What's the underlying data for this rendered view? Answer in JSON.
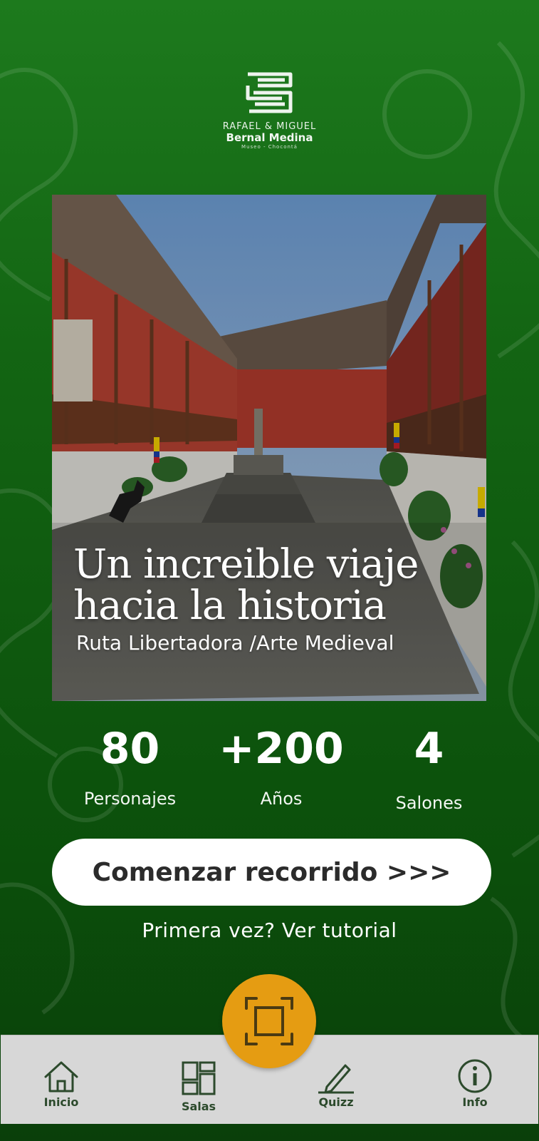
{
  "logo": {
    "line1": "RAFAEL & MIGUEL",
    "line2": "Bernal Medina",
    "line3": "Museo - Chocontá"
  },
  "hero": {
    "title_line1": "Un increible viaje",
    "title_line2": "hacia la historia",
    "subtitle": "Ruta Libertadora /Arte Medieval"
  },
  "stats": [
    {
      "value": "80",
      "label": "Personajes"
    },
    {
      "value": "+200",
      "label": "Años"
    },
    {
      "value": "4",
      "label": "Salones"
    }
  ],
  "cta": {
    "label": "Comenzar recorrido >>>"
  },
  "tutorial_link": "Primera vez? Ver tutorial",
  "nav": {
    "items": [
      {
        "label": "Inicio",
        "icon": "home-icon"
      },
      {
        "label": "Salas",
        "icon": "grid-icon"
      },
      {
        "label": "Quizz",
        "icon": "pencil-icon"
      },
      {
        "label": "Info",
        "icon": "info-icon"
      }
    ],
    "scan_icon": "scan-frame-icon"
  },
  "colors": {
    "background_top": "#1d7a1d",
    "background_bottom": "#0a3f0a",
    "accent": "#e59c12",
    "navbar": "#d7d7d7",
    "nav_icon": "#2c4a2c"
  }
}
